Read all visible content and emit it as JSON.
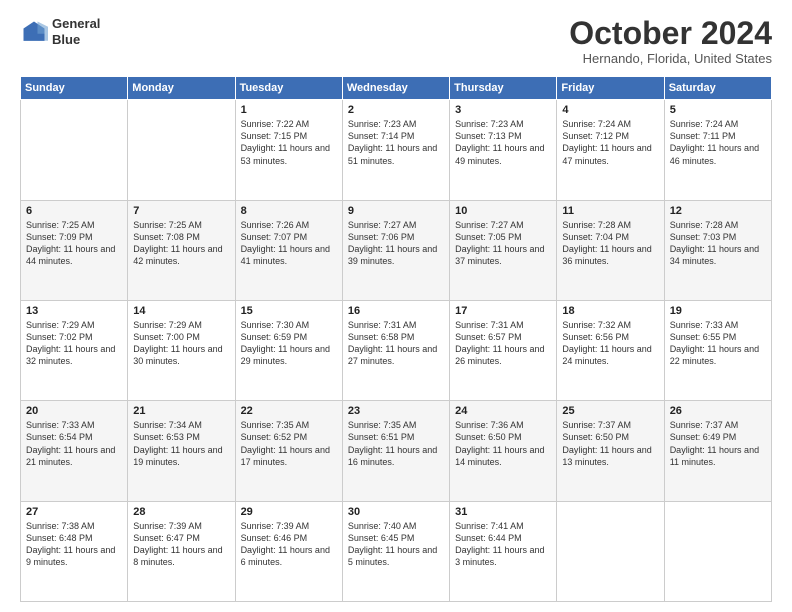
{
  "logo": {
    "line1": "General",
    "line2": "Blue"
  },
  "title": "October 2024",
  "location": "Hernando, Florida, United States",
  "days_of_week": [
    "Sunday",
    "Monday",
    "Tuesday",
    "Wednesday",
    "Thursday",
    "Friday",
    "Saturday"
  ],
  "weeks": [
    [
      {
        "day": "",
        "info": ""
      },
      {
        "day": "",
        "info": ""
      },
      {
        "day": "1",
        "info": "Sunrise: 7:22 AM\nSunset: 7:15 PM\nDaylight: 11 hours and 53 minutes."
      },
      {
        "day": "2",
        "info": "Sunrise: 7:23 AM\nSunset: 7:14 PM\nDaylight: 11 hours and 51 minutes."
      },
      {
        "day": "3",
        "info": "Sunrise: 7:23 AM\nSunset: 7:13 PM\nDaylight: 11 hours and 49 minutes."
      },
      {
        "day": "4",
        "info": "Sunrise: 7:24 AM\nSunset: 7:12 PM\nDaylight: 11 hours and 47 minutes."
      },
      {
        "day": "5",
        "info": "Sunrise: 7:24 AM\nSunset: 7:11 PM\nDaylight: 11 hours and 46 minutes."
      }
    ],
    [
      {
        "day": "6",
        "info": "Sunrise: 7:25 AM\nSunset: 7:09 PM\nDaylight: 11 hours and 44 minutes."
      },
      {
        "day": "7",
        "info": "Sunrise: 7:25 AM\nSunset: 7:08 PM\nDaylight: 11 hours and 42 minutes."
      },
      {
        "day": "8",
        "info": "Sunrise: 7:26 AM\nSunset: 7:07 PM\nDaylight: 11 hours and 41 minutes."
      },
      {
        "day": "9",
        "info": "Sunrise: 7:27 AM\nSunset: 7:06 PM\nDaylight: 11 hours and 39 minutes."
      },
      {
        "day": "10",
        "info": "Sunrise: 7:27 AM\nSunset: 7:05 PM\nDaylight: 11 hours and 37 minutes."
      },
      {
        "day": "11",
        "info": "Sunrise: 7:28 AM\nSunset: 7:04 PM\nDaylight: 11 hours and 36 minutes."
      },
      {
        "day": "12",
        "info": "Sunrise: 7:28 AM\nSunset: 7:03 PM\nDaylight: 11 hours and 34 minutes."
      }
    ],
    [
      {
        "day": "13",
        "info": "Sunrise: 7:29 AM\nSunset: 7:02 PM\nDaylight: 11 hours and 32 minutes."
      },
      {
        "day": "14",
        "info": "Sunrise: 7:29 AM\nSunset: 7:00 PM\nDaylight: 11 hours and 30 minutes."
      },
      {
        "day": "15",
        "info": "Sunrise: 7:30 AM\nSunset: 6:59 PM\nDaylight: 11 hours and 29 minutes."
      },
      {
        "day": "16",
        "info": "Sunrise: 7:31 AM\nSunset: 6:58 PM\nDaylight: 11 hours and 27 minutes."
      },
      {
        "day": "17",
        "info": "Sunrise: 7:31 AM\nSunset: 6:57 PM\nDaylight: 11 hours and 26 minutes."
      },
      {
        "day": "18",
        "info": "Sunrise: 7:32 AM\nSunset: 6:56 PM\nDaylight: 11 hours and 24 minutes."
      },
      {
        "day": "19",
        "info": "Sunrise: 7:33 AM\nSunset: 6:55 PM\nDaylight: 11 hours and 22 minutes."
      }
    ],
    [
      {
        "day": "20",
        "info": "Sunrise: 7:33 AM\nSunset: 6:54 PM\nDaylight: 11 hours and 21 minutes."
      },
      {
        "day": "21",
        "info": "Sunrise: 7:34 AM\nSunset: 6:53 PM\nDaylight: 11 hours and 19 minutes."
      },
      {
        "day": "22",
        "info": "Sunrise: 7:35 AM\nSunset: 6:52 PM\nDaylight: 11 hours and 17 minutes."
      },
      {
        "day": "23",
        "info": "Sunrise: 7:35 AM\nSunset: 6:51 PM\nDaylight: 11 hours and 16 minutes."
      },
      {
        "day": "24",
        "info": "Sunrise: 7:36 AM\nSunset: 6:50 PM\nDaylight: 11 hours and 14 minutes."
      },
      {
        "day": "25",
        "info": "Sunrise: 7:37 AM\nSunset: 6:50 PM\nDaylight: 11 hours and 13 minutes."
      },
      {
        "day": "26",
        "info": "Sunrise: 7:37 AM\nSunset: 6:49 PM\nDaylight: 11 hours and 11 minutes."
      }
    ],
    [
      {
        "day": "27",
        "info": "Sunrise: 7:38 AM\nSunset: 6:48 PM\nDaylight: 11 hours and 9 minutes."
      },
      {
        "day": "28",
        "info": "Sunrise: 7:39 AM\nSunset: 6:47 PM\nDaylight: 11 hours and 8 minutes."
      },
      {
        "day": "29",
        "info": "Sunrise: 7:39 AM\nSunset: 6:46 PM\nDaylight: 11 hours and 6 minutes."
      },
      {
        "day": "30",
        "info": "Sunrise: 7:40 AM\nSunset: 6:45 PM\nDaylight: 11 hours and 5 minutes."
      },
      {
        "day": "31",
        "info": "Sunrise: 7:41 AM\nSunset: 6:44 PM\nDaylight: 11 hours and 3 minutes."
      },
      {
        "day": "",
        "info": ""
      },
      {
        "day": "",
        "info": ""
      }
    ]
  ]
}
